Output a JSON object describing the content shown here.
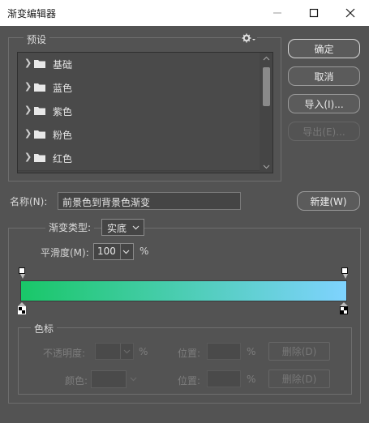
{
  "window": {
    "title": "渐变编辑器"
  },
  "presets": {
    "label": "预设",
    "folders": [
      {
        "label": "基础"
      },
      {
        "label": "蓝色"
      },
      {
        "label": "紫色"
      },
      {
        "label": "粉色"
      },
      {
        "label": "红色"
      }
    ]
  },
  "buttons": {
    "ok": "确定",
    "cancel": "取消",
    "import": "导入(I)...",
    "export": "导出(E)...",
    "new": "新建(W)"
  },
  "name": {
    "label": "名称(N):",
    "value": "前景色到背景色渐变"
  },
  "gradient": {
    "type_label": "渐变类型:",
    "type_value": "实底",
    "smoothness_label": "平滑度(M):",
    "smoothness_value": "100",
    "smoothness_unit": "%",
    "start_color": "#19c768",
    "end_color": "#7fd3ff"
  },
  "stops": {
    "label": "色标",
    "opacity_label": "不透明度:",
    "opacity_unit": "%",
    "opacity_location_label": "位置:",
    "opacity_location_unit": "%",
    "opacity_delete": "删除(D)",
    "color_label": "颜色:",
    "color_location_label": "位置:",
    "color_location_unit": "%",
    "color_delete": "删除(D)"
  }
}
